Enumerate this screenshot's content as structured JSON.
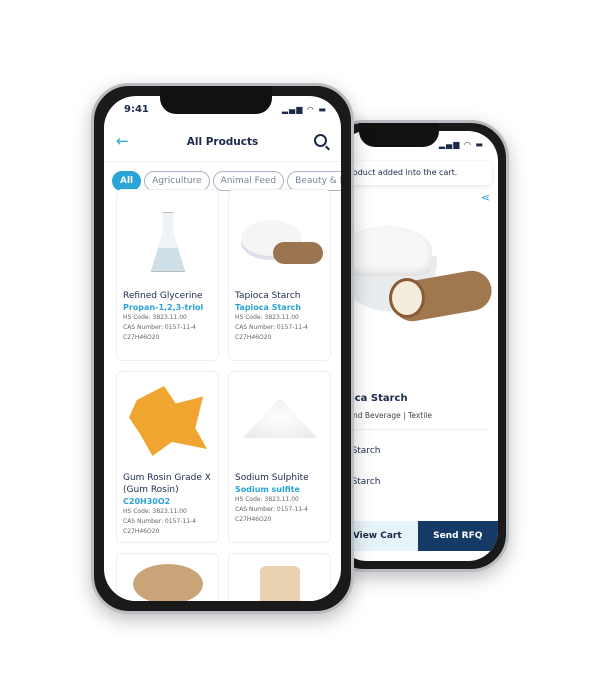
{
  "back_phone": {
    "toast": "Product added into the cart.",
    "product_title": "Tapioca Starch",
    "industries": "Food and Beverage | Textile",
    "rows": [
      "Tapioca Starch",
      "Tapioca Starch"
    ],
    "view_cart": "View Cart",
    "send_rfq": "Send RFQ",
    "icons": [
      "share-icon"
    ]
  },
  "front_phone": {
    "time": "9:41",
    "title": "All Products",
    "chips": [
      "All",
      "Agriculture",
      "Animal Feed",
      "Beauty & Personal Care"
    ],
    "products": [
      {
        "name": "Refined Glycerine",
        "sub": "Propan-1,2,3-triol",
        "hs": "HS Code: 3823.11.00",
        "cas": "CAS Number: 0157-11-4",
        "formula": "C27H46O20"
      },
      {
        "name": "Tapioca Starch",
        "sub": "Tapioca Starch",
        "hs": "HS Code: 3823.11.00",
        "cas": "CAS Number: 0157-11-4",
        "formula": "C27H46O20"
      },
      {
        "name": "Gum Rosin Grade X (Gum Rosin)",
        "sub": "C20H30O2",
        "hs": "HS Code: 3823.11.00",
        "cas": "CAS Number: 0157-11-4",
        "formula": "C27H46O20"
      },
      {
        "name": "Sodium Sulphite",
        "sub": "Sodium sulfite",
        "hs": "HS Code: 3823.11.00",
        "cas": "CAS Number: 0157-11-4",
        "formula": "C27H46O20"
      }
    ]
  },
  "colors": {
    "accent": "#2aa3d6",
    "navy": "#153a66",
    "light": "#e6f4fa"
  }
}
